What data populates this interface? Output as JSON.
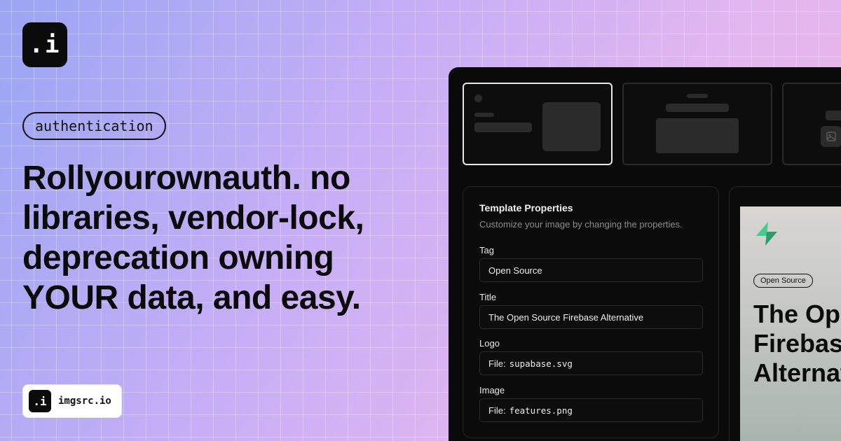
{
  "logo": {
    "text": ".i"
  },
  "tag": "authentication",
  "headline": "Rollyourownauth. no libraries, vendor-lock, deprecation owning YOUR data, and easy.",
  "brand": {
    "mark": ".i",
    "name": "imgsrc.io"
  },
  "template_properties": {
    "title": "Template Properties",
    "subtitle": "Customize your image by changing the properties.",
    "fields": [
      {
        "label": "Tag",
        "value": "Open Source"
      },
      {
        "label": "Title",
        "value": "The Open Source Firebase Alternative"
      },
      {
        "label": "Logo",
        "prefix": "File:",
        "value": "supabase.svg"
      },
      {
        "label": "Image",
        "prefix": "File:",
        "value": "features.png"
      }
    ]
  },
  "preview": {
    "tag": "Open Source",
    "title": "The Open Source Firebase Alternative",
    "logo_icon": "supabase-bolt-icon"
  },
  "colors": {
    "panel_bg": "#0a0a0a",
    "accent_green": "#3ecf8e"
  }
}
